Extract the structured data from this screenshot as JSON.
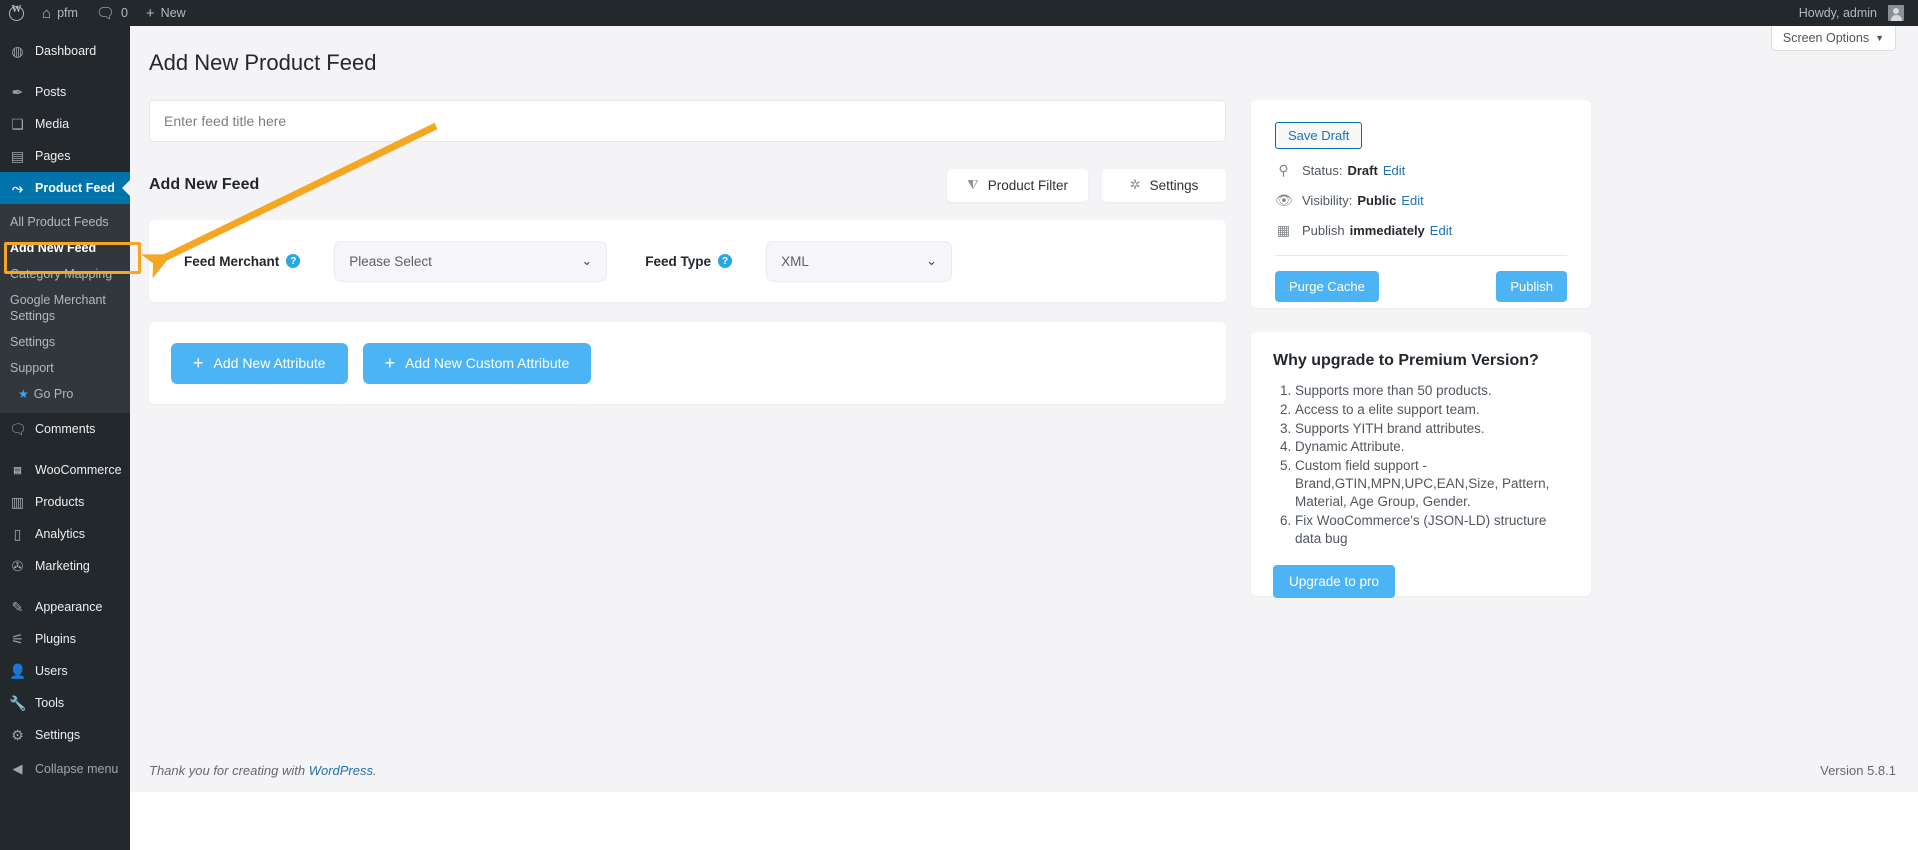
{
  "adminbar": {
    "logo_icon": "wordpress-logo-icon",
    "site_name": "pfm",
    "home_icon": "home-icon",
    "comments_icon": "comment-bubble-icon",
    "comments_count": "0",
    "new_icon": "plus-icon",
    "new_label": "New",
    "howdy": "Howdy, admin",
    "avatar_icon": "avatar-icon"
  },
  "sidebar": {
    "items": [
      {
        "label": "Dashboard",
        "icon": "dashboard-icon",
        "glyph": "◉"
      },
      {
        "label": "Posts",
        "icon": "pin-icon",
        "glyph": "📌"
      },
      {
        "label": "Media",
        "icon": "media-icon",
        "glyph": "🖼"
      },
      {
        "label": "Pages",
        "icon": "pages-icon",
        "glyph": "🗐"
      },
      {
        "label": "Product Feed",
        "icon": "chart-cart-icon",
        "glyph": "📈"
      },
      {
        "label": "Comments",
        "icon": "comment-bubble-icon",
        "glyph": "💬"
      },
      {
        "label": "WooCommerce",
        "icon": "woocommerce-icon",
        "glyph": "woo"
      },
      {
        "label": "Products",
        "icon": "products-icon",
        "glyph": "▤"
      },
      {
        "label": "Analytics",
        "icon": "bar-chart-icon",
        "glyph": "▮"
      },
      {
        "label": "Marketing",
        "icon": "megaphone-icon",
        "glyph": "📣"
      },
      {
        "label": "Appearance",
        "icon": "paintbrush-icon",
        "glyph": "🖌"
      },
      {
        "label": "Plugins",
        "icon": "plug-icon",
        "glyph": "🔌"
      },
      {
        "label": "Users",
        "icon": "user-icon",
        "glyph": "👤"
      },
      {
        "label": "Tools",
        "icon": "wrench-icon",
        "glyph": "🔧"
      },
      {
        "label": "Settings",
        "icon": "sliders-icon",
        "glyph": "⚙"
      }
    ],
    "submenu": [
      {
        "label": "All Product Feeds"
      },
      {
        "label": "Add New Feed"
      },
      {
        "label": "Category Mapping"
      },
      {
        "label": "Google Merchant Settings"
      },
      {
        "label": "Settings"
      },
      {
        "label": "Support"
      },
      {
        "label": "Go Pro"
      }
    ],
    "active_item": "Product Feed",
    "active_subitem": "Add New Feed",
    "collapse_label": "Collapse menu",
    "collapse_icon": "collapse-arrow-icon",
    "star_icon": "star-icon"
  },
  "screen_options": {
    "label": "Screen Options",
    "caret": "▼"
  },
  "main": {
    "page_title": "Add New Product Feed",
    "title_placeholder": "Enter feed title here",
    "title_value": "",
    "section_heading": "Add New Feed",
    "buttons": [
      {
        "label": "Product Filter",
        "icon": "funnel-icon",
        "glyph": "⧩"
      },
      {
        "label": "Settings",
        "icon": "gear-icon",
        "glyph": "✲"
      }
    ],
    "form": {
      "merchant_label": "Feed Merchant",
      "merchant_help_icon": "help-question-icon",
      "merchant_value": "Please Select",
      "merchant_options": [
        "Please Select"
      ],
      "feedtype_label": "Feed Type",
      "feedtype_help_icon": "help-question-icon",
      "feedtype_value": "XML",
      "feedtype_options": [
        "XML"
      ],
      "caret_icon": "chevron-down-icon"
    },
    "attribute_buttons": [
      {
        "label": "Add New Attribute",
        "icon": "plus-icon"
      },
      {
        "label": "Add New Custom Attribute",
        "icon": "plus-icon"
      }
    ]
  },
  "publish_box": {
    "save_draft": "Save Draft",
    "status_icon": "pin-marker-icon",
    "status_prefix": "Status:",
    "status_value": "Draft",
    "status_edit": "Edit",
    "visibility_icon": "eye-icon",
    "visibility_prefix": "Visibility:",
    "visibility_value": "Public",
    "visibility_edit": "Edit",
    "schedule_icon": "calendar-icon",
    "schedule_prefix": "Publish",
    "schedule_value": "immediately",
    "schedule_edit": "Edit",
    "purge_cache": "Purge Cache",
    "publish": "Publish"
  },
  "premium_box": {
    "title": "Why upgrade to Premium Version?",
    "items": [
      "Supports more than 50 products.",
      "Access to a elite support team.",
      "Supports YITH brand attributes.",
      "Dynamic Attribute.",
      "Custom field support - Brand,GTIN,MPN,UPC,EAN,Size, Pattern, Material, Age Group, Gender.",
      "Fix WooCommerce's (JSON-LD) structure data bug"
    ],
    "cta": "Upgrade to pro"
  },
  "footer": {
    "thanks_prefix": "Thank you for creating with ",
    "wordpress_link": "WordPress",
    "thanks_suffix": ".",
    "version": "Version 5.8.1"
  },
  "annotation": {
    "arrow_color": "#f5a623",
    "highlight_color": "#f5a623",
    "points_to": "Add New Feed"
  }
}
